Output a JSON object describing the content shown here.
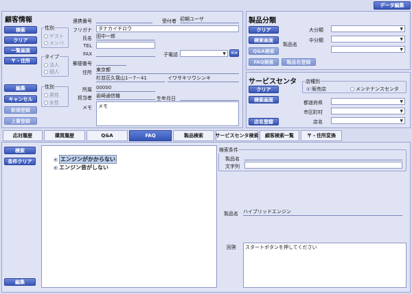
{
  "header": {
    "data_edit_button": "データ編集"
  },
  "customer": {
    "title": "顧客情報",
    "buttons": {
      "search": "検索",
      "clear": "クリア",
      "list": "一覧画面",
      "te_address": "〒・住所",
      "edit": "編集",
      "cancel": "キャンセル",
      "new_register": "新規登録",
      "overwrite_register": "上書登録"
    },
    "gender_group": {
      "title": "性別",
      "options": [
        "ゲスト",
        "メンバ"
      ]
    },
    "type_group": {
      "title": "タイプ",
      "options": [
        "法人",
        "個人"
      ]
    },
    "sex_group": {
      "title": "性別",
      "options": [
        "男性",
        "女性"
      ]
    },
    "fields": {
      "accept_no": {
        "label": "連携番号",
        "value": ""
      },
      "receiver": {
        "label": "受付者",
        "value": "初期ユーザ"
      },
      "furigana": {
        "label": "フリガナ",
        "value": "タナカイチロウ"
      },
      "name": {
        "label": "氏名",
        "value": "田中一郎"
      },
      "tel": {
        "label": "TEL",
        "value": ""
      },
      "fax": {
        "label": "FAX",
        "value": ""
      },
      "child_phone": {
        "label": "子電話",
        "value": ""
      },
      "child_phone_btn": "<=",
      "zip": {
        "label": "郵便番号",
        "value": ""
      },
      "address": {
        "label": "住所",
        "value": "東京都"
      },
      "address2": {
        "value": "杉並区久我山1－7－41"
      },
      "address_kana": {
        "value": "イワサキツウシンキ"
      },
      "affiliation": {
        "label": "所属",
        "value": "00000"
      },
      "person": {
        "label": "担当者",
        "value": "岩崎通信機"
      },
      "birthday": {
        "label": "生年月日",
        "value": ""
      },
      "memo": {
        "label": "メモ",
        "value": "メモ"
      }
    }
  },
  "product_class": {
    "title": "製品分類",
    "buttons": {
      "clear": "クリア",
      "search": "検索画面",
      "qa_search": "Q&A検索",
      "faq_search": "FAQ検索",
      "product_register": "製品名登録"
    },
    "product_name_label": "製品名",
    "major_label": "大分類",
    "middle_label": "中分類"
  },
  "service": {
    "title": "サービスセンタ",
    "buttons": {
      "clear": "クリア",
      "search": "検索画面",
      "store_register": "店名登録"
    },
    "store_type": {
      "title": "店種別",
      "options": [
        "販売店",
        "メンテナンスセンタ"
      ]
    },
    "pref_label": "都道府県",
    "city_label": "市区町村",
    "store_label": "店名"
  },
  "tabs": [
    {
      "label": "応対履歴"
    },
    {
      "label": "購買履歴"
    },
    {
      "label": "Q&A"
    },
    {
      "label": "FAQ"
    },
    {
      "label": "製品検索"
    },
    {
      "label": "サービスセンタ検索"
    },
    {
      "label": "顧客検索一覧"
    },
    {
      "label": "〒・住所変換"
    }
  ],
  "faq": {
    "buttons": {
      "search": "検索",
      "condition_clear": "条件クリア",
      "edit": "編集"
    },
    "list": [
      {
        "text": "エンジンがかからない"
      },
      {
        "text": "エンジン音がしない"
      }
    ],
    "conditions": {
      "title": "検索条件",
      "product_name_label": "製品名",
      "text_label": "文字列"
    },
    "detail": {
      "product_label": "製品名",
      "product_value": "ハイブリッドエンジン",
      "answer_label": "回答",
      "answer_value": "スタートボタンを押してください"
    }
  }
}
